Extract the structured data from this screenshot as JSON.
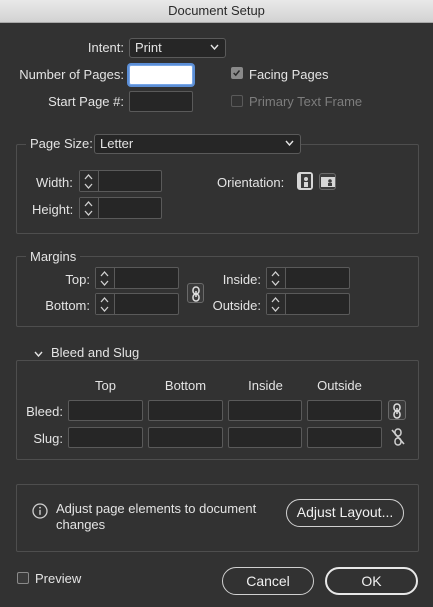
{
  "window": {
    "title": "Document Setup"
  },
  "intent": {
    "label": "Intent:",
    "value": "Print"
  },
  "pages": {
    "number_label": "Number of Pages:",
    "number_value": "",
    "start_label": "Start Page #:",
    "start_value": "",
    "facing_label": "Facing Pages",
    "facing_checked": true,
    "primary_label": "Primary Text Frame",
    "primary_checked": false
  },
  "page_size": {
    "label": "Page Size:",
    "value": "Letter",
    "width_label": "Width:",
    "width_value": "",
    "height_label": "Height:",
    "height_value": "",
    "orientation_label": "Orientation:",
    "orientation_options": [
      "portrait-icon",
      "landscape-icon"
    ]
  },
  "margins": {
    "label": "Margins",
    "top_label": "Top:",
    "bottom_label": "Bottom:",
    "inside_label": "Inside:",
    "outside_label": "Outside:",
    "top_value": "",
    "bottom_value": "",
    "inside_value": "",
    "outside_value": "",
    "link_icon": "link-icon"
  },
  "bleed_slug": {
    "label": "Bleed and Slug",
    "expanded": true,
    "columns": [
      "Top",
      "Bottom",
      "Inside",
      "Outside"
    ],
    "bleed_label": "Bleed:",
    "slug_label": "Slug:",
    "bleed_values": [
      "",
      "",
      "",
      ""
    ],
    "slug_values": [
      "",
      "",
      "",
      ""
    ]
  },
  "adjust": {
    "message": "Adjust page elements to document changes",
    "message_line1": "Adjust page elements to document",
    "message_line2": "changes",
    "button_label": "Adjust Layout..."
  },
  "footer": {
    "preview_label": "Preview",
    "preview_checked": false,
    "cancel_label": "Cancel",
    "ok_label": "OK"
  },
  "colors": {
    "background": "#323232",
    "field": "#262626",
    "border": "#5a5a5a",
    "focus": "#5b8ed6"
  }
}
